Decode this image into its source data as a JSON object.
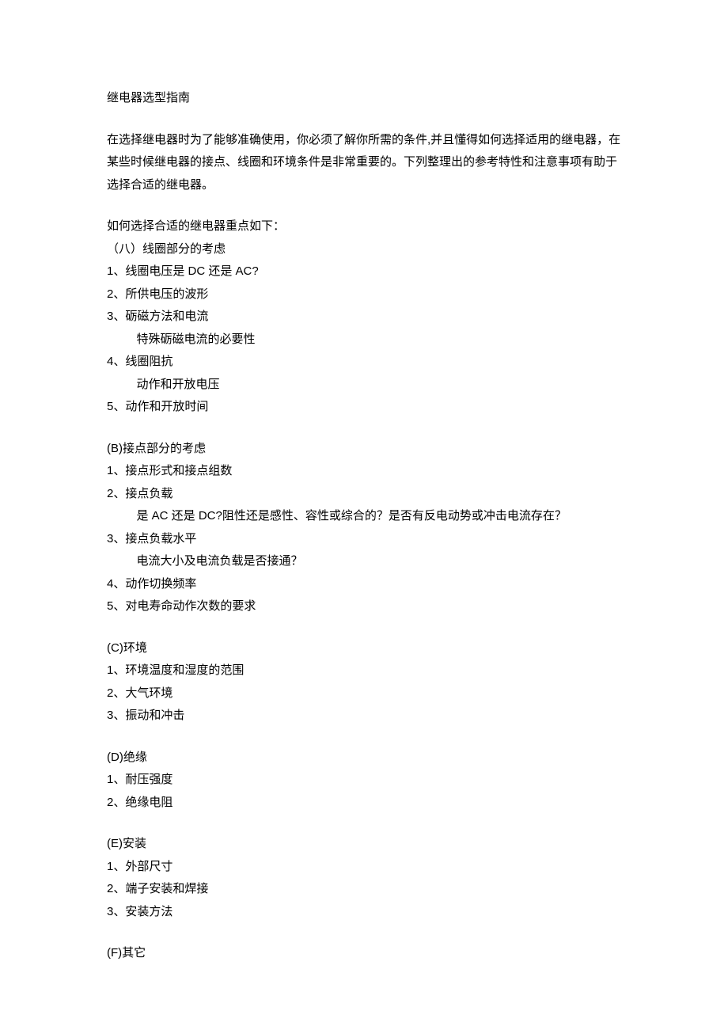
{
  "title": "继电器选型指南",
  "intro": "在选择继电器时为了能够准确使用，你必须了解你所需的条件,并且懂得如何选择适用的继电器，在某些时候继电器的接点、线圈和环境条件是非常重要的。下列整理出的参考特性和注意事项有助于选择合适的继电器。",
  "subtitle": "如何选择合适的继电器重点如下：",
  "sections": [
    {
      "heading": "（八）线圈部分的考虑",
      "items": [
        {
          "num": "1、",
          "text": "线圈电压是 DC 还是 AC?"
        },
        {
          "num": "2、",
          "text": "所供电压的波形"
        },
        {
          "num": "3、",
          "text": "砺磁方法和电流",
          "sub": "特殊砺磁电流的必要性"
        },
        {
          "num": "4、",
          "text": "线圈阻抗",
          "sub": "动作和开放电压"
        },
        {
          "num": "5、",
          "text": "动作和开放时间"
        }
      ]
    },
    {
      "heading": "(B)接点部分的考虑",
      "items": [
        {
          "num": "1、",
          "text": "接点形式和接点组数"
        },
        {
          "num": "2、",
          "text": "接点负载",
          "sub": "是 AC 还是 DC?阻性还是感性、容性或综合的？是否有反电动势或冲击电流存在？"
        },
        {
          "num": "3、",
          "text": "接点负载水平",
          "sub": "电流大小及电流负载是否接通？"
        },
        {
          "num": "4、",
          "text": "动作切换频率"
        },
        {
          "num": "5、",
          "text": "对电寿命动作次数的要求"
        }
      ]
    },
    {
      "heading": "(C)环境",
      "items": [
        {
          "num": "1、",
          "text": "环境温度和湿度的范围"
        },
        {
          "num": "2、",
          "text": "大气环境"
        },
        {
          "num": "3、",
          "text": "振动和冲击"
        }
      ]
    },
    {
      "heading": "(D)绝缘",
      "items": [
        {
          "num": "1、",
          "text": "耐压强度"
        },
        {
          "num": "2、",
          "text": "绝缘电阻"
        }
      ]
    },
    {
      "heading": "(E)安装",
      "items": [
        {
          "num": "1、",
          "text": "外部尺寸"
        },
        {
          "num": "2、",
          "text": "端子安装和焊接"
        },
        {
          "num": "3、",
          "text": "安装方法"
        }
      ]
    },
    {
      "heading": "(F)其它",
      "items": []
    }
  ]
}
